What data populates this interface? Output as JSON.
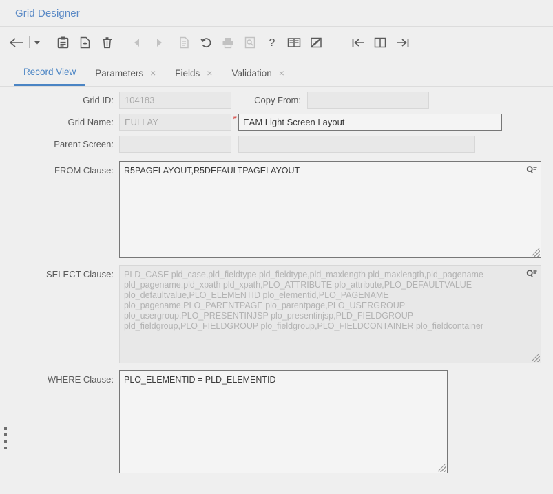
{
  "app": {
    "title": "Grid Designer"
  },
  "toolbar": {
    "items": [
      {
        "name": "back-arrow-icon",
        "label": "Back",
        "icon": "arrow-left",
        "enabled": true
      },
      {
        "name": "toolbar-separator",
        "label": "",
        "icon": "separator",
        "enabled": true
      },
      {
        "name": "dropdown-caret-icon",
        "label": "More",
        "icon": "caret-down",
        "enabled": true
      },
      {
        "name": "save-icon",
        "label": "Save",
        "icon": "save",
        "enabled": true
      },
      {
        "name": "new-record-icon",
        "label": "New Record",
        "icon": "new-doc",
        "enabled": true
      },
      {
        "name": "delete-icon",
        "label": "Delete",
        "icon": "trash",
        "enabled": true
      },
      {
        "name": "previous-record-icon",
        "label": "Previous",
        "icon": "triangle-left",
        "enabled": false
      },
      {
        "name": "next-record-icon",
        "label": "Next",
        "icon": "triangle-right",
        "enabled": false
      },
      {
        "name": "copy-record-icon",
        "label": "Copy Record",
        "icon": "copy-doc",
        "enabled": false
      },
      {
        "name": "undo-icon",
        "label": "Undo",
        "icon": "undo",
        "enabled": true
      },
      {
        "name": "print-icon",
        "label": "Print",
        "icon": "printer",
        "enabled": false
      },
      {
        "name": "inspect-icon",
        "label": "Inspect",
        "icon": "doc-search",
        "enabled": false
      },
      {
        "name": "help-icon",
        "label": "Help",
        "icon": "question-mark",
        "enabled": true
      },
      {
        "name": "book-icon",
        "label": "Documentation",
        "icon": "book",
        "enabled": true
      },
      {
        "name": "no-edit-icon",
        "label": "Read Only",
        "icon": "pen-slash",
        "enabled": true
      },
      {
        "name": "toolbar-separator-2",
        "label": "",
        "icon": "separator",
        "enabled": true
      },
      {
        "name": "collapse-left-icon",
        "label": "Collapse Left",
        "icon": "bar-arrow-left",
        "enabled": true
      },
      {
        "name": "split-view-icon",
        "label": "Split View",
        "icon": "split-panel",
        "enabled": true
      },
      {
        "name": "collapse-right-icon",
        "label": "Collapse Right",
        "icon": "bar-arrow-right",
        "enabled": true
      }
    ]
  },
  "tabs": [
    {
      "label": "Record View",
      "active": true,
      "closable": false
    },
    {
      "label": "Parameters",
      "active": false,
      "closable": true
    },
    {
      "label": "Fields",
      "active": false,
      "closable": true
    },
    {
      "label": "Validation",
      "active": false,
      "closable": true
    }
  ],
  "tab_close_glyph": "×",
  "form": {
    "grid_id": {
      "label": "Grid ID:",
      "value": "104183",
      "enabled": false
    },
    "copy_from": {
      "label": "Copy From:",
      "value": "",
      "enabled": false
    },
    "grid_name": {
      "label": "Grid Name:",
      "value": "EULLAY",
      "enabled": false
    },
    "grid_description": {
      "value": "EAM Light Screen Layout",
      "enabled": true,
      "required": true
    },
    "parent_screen": {
      "label": "Parent Screen:",
      "value": "",
      "enabled": false
    },
    "parent_screen_desc": {
      "value": "",
      "enabled": false
    },
    "from_clause": {
      "label": "FROM Clause:",
      "value": "R5PAGELAYOUT,R5DEFAULTPAGELAYOUT",
      "enabled": true
    },
    "select_clause": {
      "label": "SELECT Clause:",
      "value": "PLD_CASE pld_case,pld_fieldtype pld_fieldtype,pld_maxlength pld_maxlength,pld_pagename pld_pagename,pld_xpath pld_xpath,PLO_ATTRIBUTE plo_attribute,PLO_DEFAULTVALUE plo_defaultvalue,PLO_ELEMENTID plo_elementid,PLO_PAGENAME plo_pagename,PLO_PARENTPAGE plo_parentpage,PLO_USERGROUP plo_usergroup,PLO_PRESENTINJSP plo_presentinjsp,PLD_FIELDGROUP pld_fieldgroup,PLO_FIELDGROUP plo_fieldgroup,PLO_FIELDCONTAINER plo_fieldcontainer",
      "enabled": false
    },
    "where_clause": {
      "label": "WHERE Clause:",
      "value": "PLO_ELEMENTID = PLD_ELEMENTID",
      "enabled": true
    },
    "required_marker": "*",
    "lookup_icon_name": "lookup-search-icon"
  },
  "colors": {
    "accent": "#4a84c4",
    "title": "#5b8ac6",
    "required": "#d9534f",
    "page_bg": "#efefef",
    "disabled_field": "#e8e8e8",
    "enabled_field": "#f4f4f4"
  }
}
